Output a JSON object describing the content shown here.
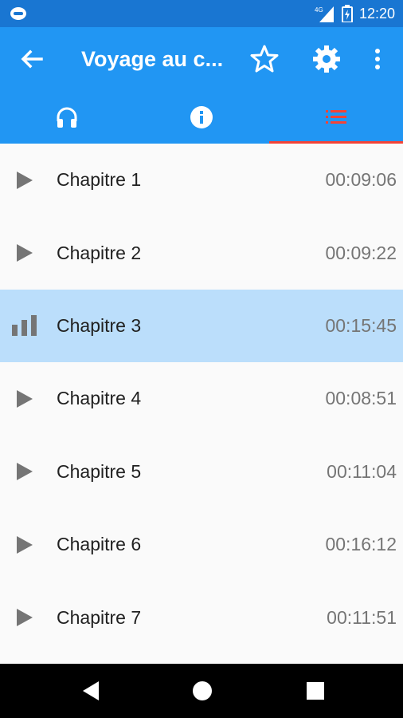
{
  "status": {
    "time": "12:20",
    "network": "4G"
  },
  "appbar": {
    "title": "Voyage au c..."
  },
  "tabs": [
    {
      "name": "listen",
      "icon": "headphones-icon"
    },
    {
      "name": "info",
      "icon": "info-icon"
    },
    {
      "name": "chapters",
      "icon": "list-icon",
      "selected": true
    }
  ],
  "chapters": [
    {
      "label": "Chapitre 1",
      "duration": "00:09:06",
      "icon": "play-icon"
    },
    {
      "label": "Chapitre 2",
      "duration": "00:09:22",
      "icon": "play-icon"
    },
    {
      "label": "Chapitre 3",
      "duration": "00:15:45",
      "icon": "equalizer-icon",
      "active": true
    },
    {
      "label": "Chapitre 4",
      "duration": "00:08:51",
      "icon": "play-icon"
    },
    {
      "label": "Chapitre 5",
      "duration": "00:11:04",
      "icon": "play-icon"
    },
    {
      "label": "Chapitre 6",
      "duration": "00:16:12",
      "icon": "play-icon"
    },
    {
      "label": "Chapitre 7",
      "duration": "00:11:51",
      "icon": "play-icon"
    }
  ],
  "colors": {
    "primary": "#2196f3",
    "status": "#1976d2",
    "indicator": "#f44336",
    "active_row": "#bbdefb"
  }
}
